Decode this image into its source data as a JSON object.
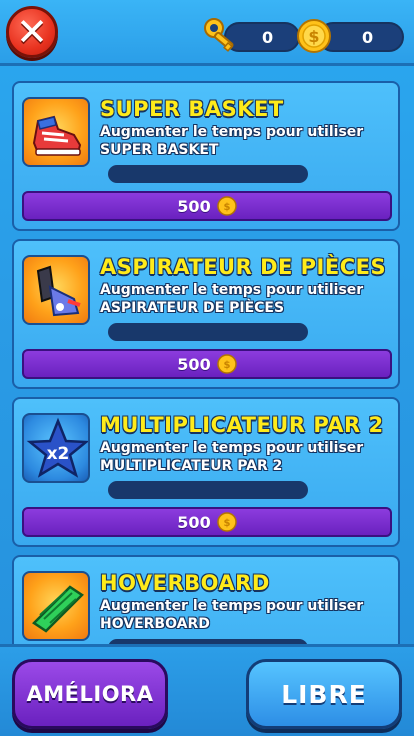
{
  "header": {
    "keys_count": "0",
    "coins_count": "0"
  },
  "powerups": [
    {
      "title": "SUPER BASKET",
      "description": "Augmenter le temps pour utiliser SUPER BASKET",
      "price": "500",
      "icon": "sneakers-icon",
      "progress": 0
    },
    {
      "title": "ASPIRATEUR DE PIÈCES",
      "description": "Augmenter le temps pour utiliser ASPIRATEUR DE PIÈCES",
      "price": "500",
      "icon": "coin-magnet-icon",
      "progress": 0
    },
    {
      "title": "MULTIPLICATEUR PAR 2",
      "description": "Augmenter le temps pour utiliser MULTIPLICATEUR PAR 2",
      "price": "500",
      "icon": "x2-star-icon",
      "icon_text": "x2",
      "progress": 0
    },
    {
      "title": "HOVERBOARD",
      "description": "Augmenter le temps pour utiliser HOVERBOARD",
      "icon": "hoverboard-icon",
      "progress": 0
    }
  ],
  "bottom": {
    "ameliora_label": "AMÉLIORA",
    "libre_label": "LIBRE"
  },
  "colors": {
    "title_yellow": "#ffeb1a",
    "buy_purple": "#6a21bf",
    "track_navy": "#18386b",
    "close_red": "#e8321f"
  }
}
